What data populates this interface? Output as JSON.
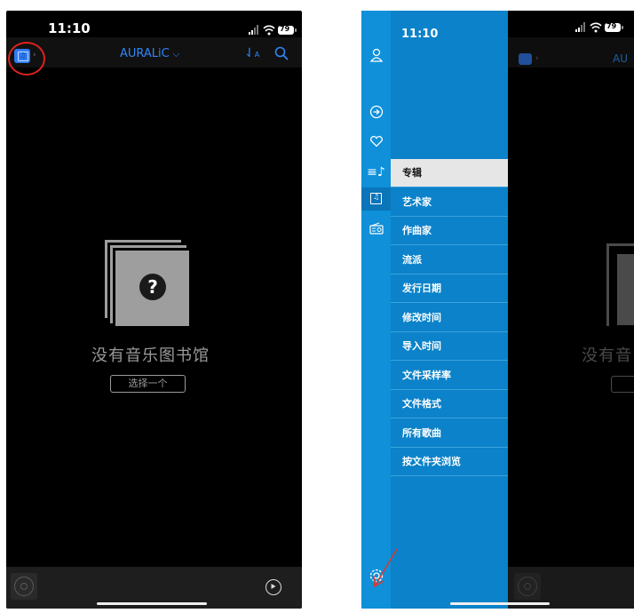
{
  "left": {
    "status": {
      "time": "11:10",
      "battery": "79"
    },
    "header": {
      "title": "AURALiC"
    },
    "empty": {
      "message": "没有音乐图书馆",
      "button": "选择一个"
    }
  },
  "right": {
    "status": {
      "time": "11:10",
      "battery": "79"
    },
    "header_fragment": "AU",
    "empty_fragment": "没有音",
    "menu": [
      {
        "label": "专辑",
        "selected": true
      },
      {
        "label": "艺术家"
      },
      {
        "label": "作曲家"
      },
      {
        "label": "流派"
      },
      {
        "label": "发行日期"
      },
      {
        "label": "修改时间"
      },
      {
        "label": "导入时间"
      },
      {
        "label": "文件采样率"
      },
      {
        "label": "文件格式"
      },
      {
        "label": "所有歌曲"
      },
      {
        "label": "按文件夹浏览"
      }
    ]
  },
  "colors": {
    "accent": "#2f86f6",
    "drawer": "#0b82c9",
    "rail": "#0f90d9",
    "annotation": "#e0221c"
  }
}
